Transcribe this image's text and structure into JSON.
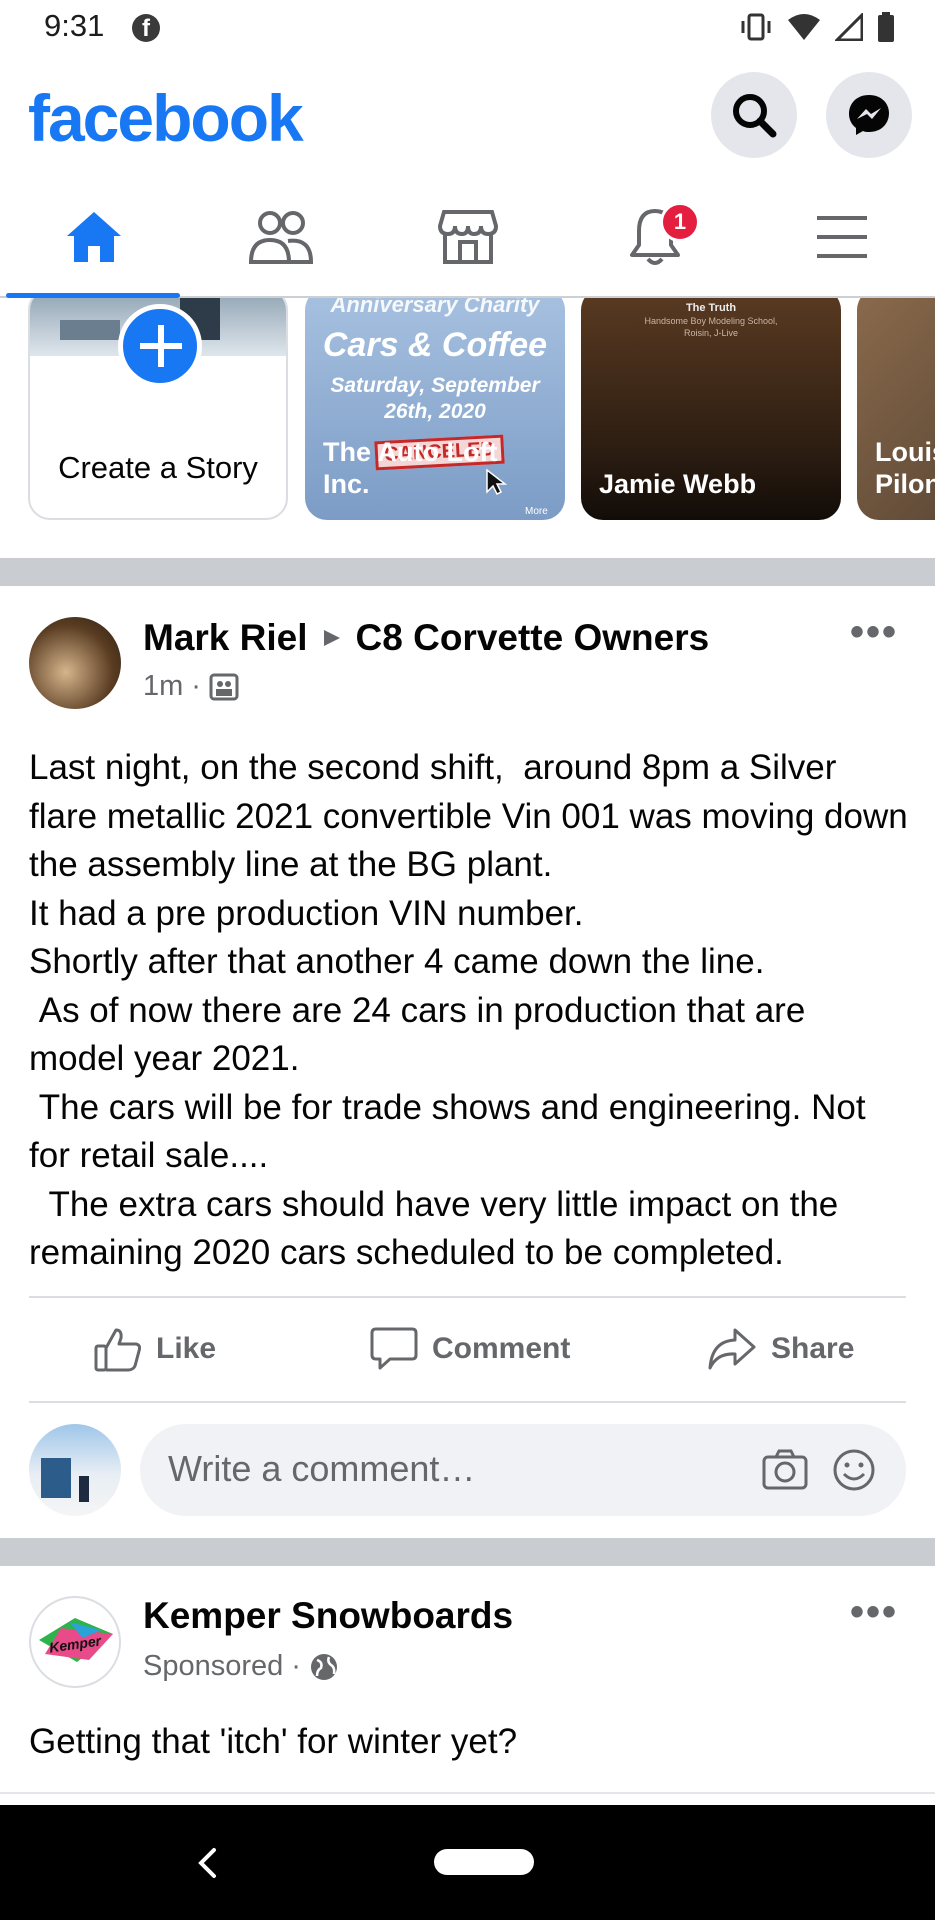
{
  "status_bar": {
    "time": "9:31"
  },
  "header": {
    "logo": "facebook",
    "search_icon": "search-icon",
    "messenger_icon": "messenger-icon"
  },
  "tabs": [
    {
      "name": "home",
      "icon": "home-icon",
      "active": true
    },
    {
      "name": "friends",
      "icon": "friends-icon"
    },
    {
      "name": "marketplace",
      "icon": "marketplace-icon"
    },
    {
      "name": "notifications",
      "icon": "bell-icon",
      "badge": "1"
    },
    {
      "name": "menu",
      "icon": "menu-icon"
    }
  ],
  "stories": {
    "create_label": "Create a Story",
    "items": [
      {
        "name": "The Auto Loft Inc.",
        "line1": "The Auto Loft",
        "line2": "Inc.",
        "overlay_top": "Anniversary Charity",
        "overlay_title": "Cars & Coffee",
        "overlay_date": "Saturday, September",
        "overlay_date2": "26th, 2020",
        "stamp": "CANCELED",
        "more": "More"
      },
      {
        "name": "Jamie Webb",
        "overlay_title": "The Truth",
        "overlay_sub": "Handsome Boy Modeling School,",
        "overlay_sub2": "Roisin, J-Live"
      },
      {
        "name_line1": "Louis",
        "name_line2": "Pilon"
      }
    ]
  },
  "post": {
    "author": "Mark Riel",
    "group": "C8 Corvette Owners",
    "time": "1m",
    "text": "Last night, on the second shift,  around 8pm a Silver flare metallic 2021 convertible Vin 001 was moving down the assembly line at the BG plant.\nIt had a pre production VIN number.\nShortly after that another 4 came down the line.\n As of now there are 24 cars in production that are model year 2021.\n The cars will be for trade shows and engineering. Not for retail sale....\n  The extra cars should have very little impact on the remaining 2020 cars scheduled to be completed.",
    "actions": {
      "like": "Like",
      "comment": "Comment",
      "share": "Share"
    },
    "comment_placeholder": "Write a comment…"
  },
  "ad": {
    "author": "Kemper Snowboards",
    "meta": "Sponsored",
    "logo_text": "Kemper",
    "text": "Getting that 'itch' for winter yet?"
  },
  "colors": {
    "brand": "#1877f2",
    "badge": "#e41e3f",
    "muted": "#65676b"
  }
}
